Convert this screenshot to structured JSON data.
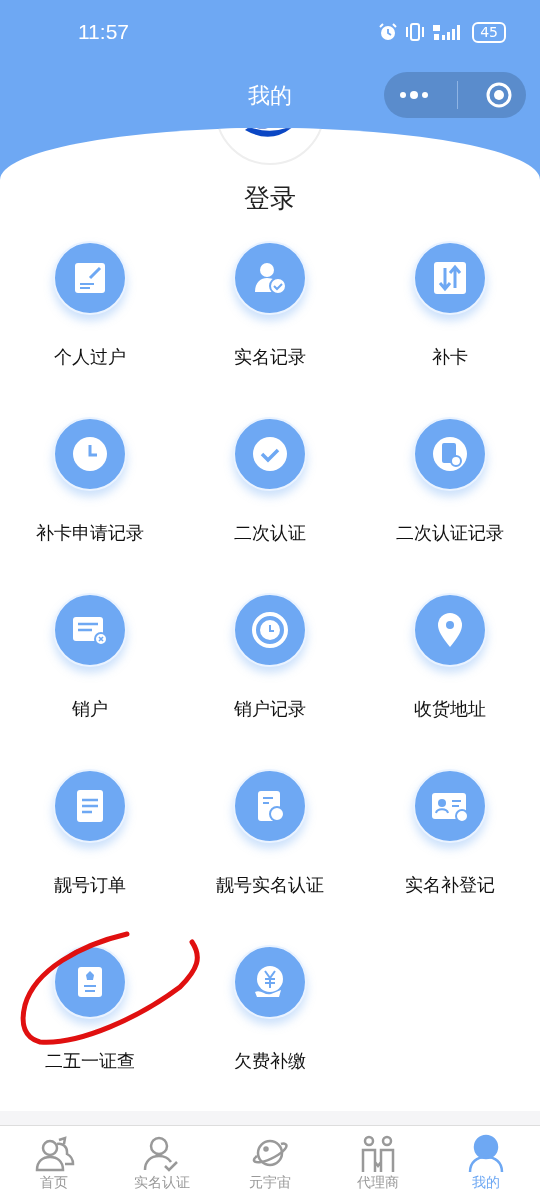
{
  "status_bar": {
    "time": "11:57",
    "battery": "45"
  },
  "nav": {
    "title": "我的"
  },
  "profile": {
    "login": "登录"
  },
  "menu": [
    {
      "label": "个人过户",
      "kind": "edit"
    },
    {
      "label": "实名记录",
      "kind": "user-check"
    },
    {
      "label": "补卡",
      "kind": "swap"
    },
    {
      "label": "补卡申请记录",
      "kind": "clock"
    },
    {
      "label": "二次认证",
      "kind": "check"
    },
    {
      "label": "二次认证记录",
      "kind": "doc-clock"
    },
    {
      "label": "销户",
      "kind": "card-x"
    },
    {
      "label": "销户记录",
      "kind": "history"
    },
    {
      "label": "收货地址",
      "kind": "pin"
    },
    {
      "label": "靓号订单",
      "kind": "list"
    },
    {
      "label": "靓号实名认证",
      "kind": "doc-edit"
    },
    {
      "label": "实名补登记",
      "kind": "id-card"
    },
    {
      "label": "二五一证查",
      "kind": "badge"
    },
    {
      "label": "欠费补缴",
      "kind": "yen"
    }
  ],
  "tabs": [
    {
      "label": "首页",
      "kind": "home",
      "selected": false
    },
    {
      "label": "实名认证",
      "kind": "verify",
      "selected": false
    },
    {
      "label": "元宇宙",
      "kind": "planet",
      "selected": false
    },
    {
      "label": "代理商",
      "kind": "agent",
      "selected": false
    },
    {
      "label": "我的",
      "kind": "me",
      "selected": true
    }
  ]
}
